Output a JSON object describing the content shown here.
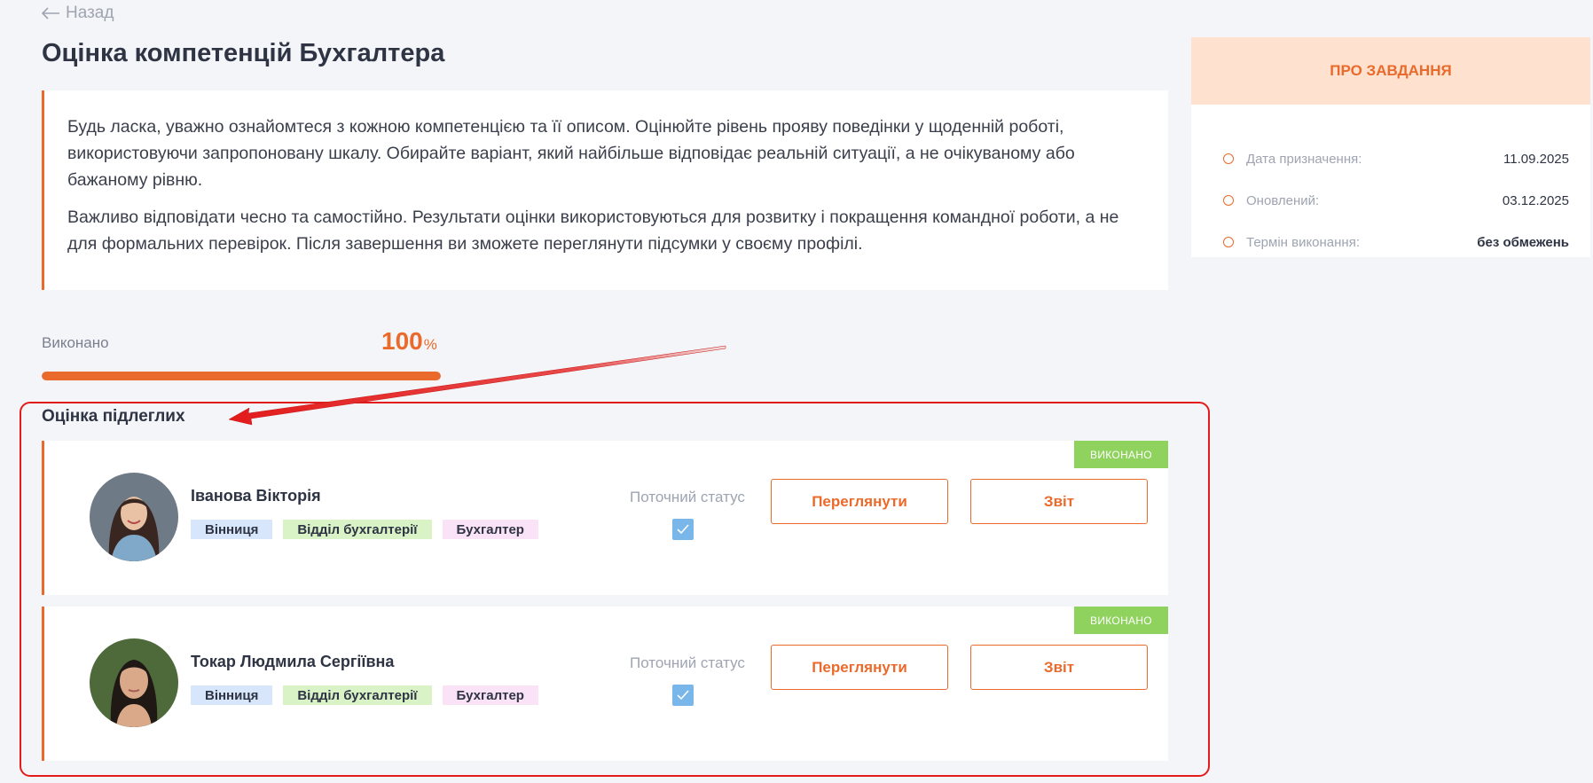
{
  "nav": {
    "back_label": "Назад"
  },
  "page": {
    "title": "Оцінка компетенцій Бухгалтера"
  },
  "intro": {
    "paragraph_1": "Будь ласка, уважно ознайомтеся з кожною компетенцією та її описом. Оцінюйте рівень прояву поведінки у щоденній роботі, використовуючи запропоновану шкалу. Обирайте варіант, який найбільше відповідає реальній ситуації, а не очікуваному або бажаному рівню.",
    "paragraph_2": "Важливо відповідати чесно та самостійно. Результати оцінки використовуються для розвитку і покращення командної роботи, а не для формальних перевірок. Після завершення ви зможете переглянути підсумки у своєму профілі."
  },
  "progress": {
    "label": "Виконано",
    "value": "100",
    "unit": "%",
    "fraction": 1.0
  },
  "subordinates": {
    "title": "Оцінка підлеглих",
    "status_label": "Поточний статус",
    "view_label": "Переглянути",
    "report_label": "Звіт",
    "items": [
      {
        "name": "Іванова Вікторія",
        "badge": "Виконано",
        "city": "Вінниця",
        "department": "Відділ бухгалтерії",
        "position": "Бухгалтер",
        "status_checked": true
      },
      {
        "name": "Токар Людмила Сергіївна",
        "badge": "Виконано",
        "city": "Вінниця",
        "department": "Відділ бухгалтерії",
        "position": "Бухгалтер",
        "status_checked": true
      }
    ]
  },
  "about": {
    "title": "ПРО ЗАВДАННЯ",
    "rows": [
      {
        "label": "Дата призначення:",
        "value": "11.09.2025"
      },
      {
        "label": "Оновлений:",
        "value": "03.12.2025"
      },
      {
        "label": "Термін виконання:",
        "value": "без обмежень"
      }
    ]
  },
  "colors": {
    "accent": "#ea6a2b",
    "done": "#8fd25e",
    "annotation": "#e31b1b"
  }
}
